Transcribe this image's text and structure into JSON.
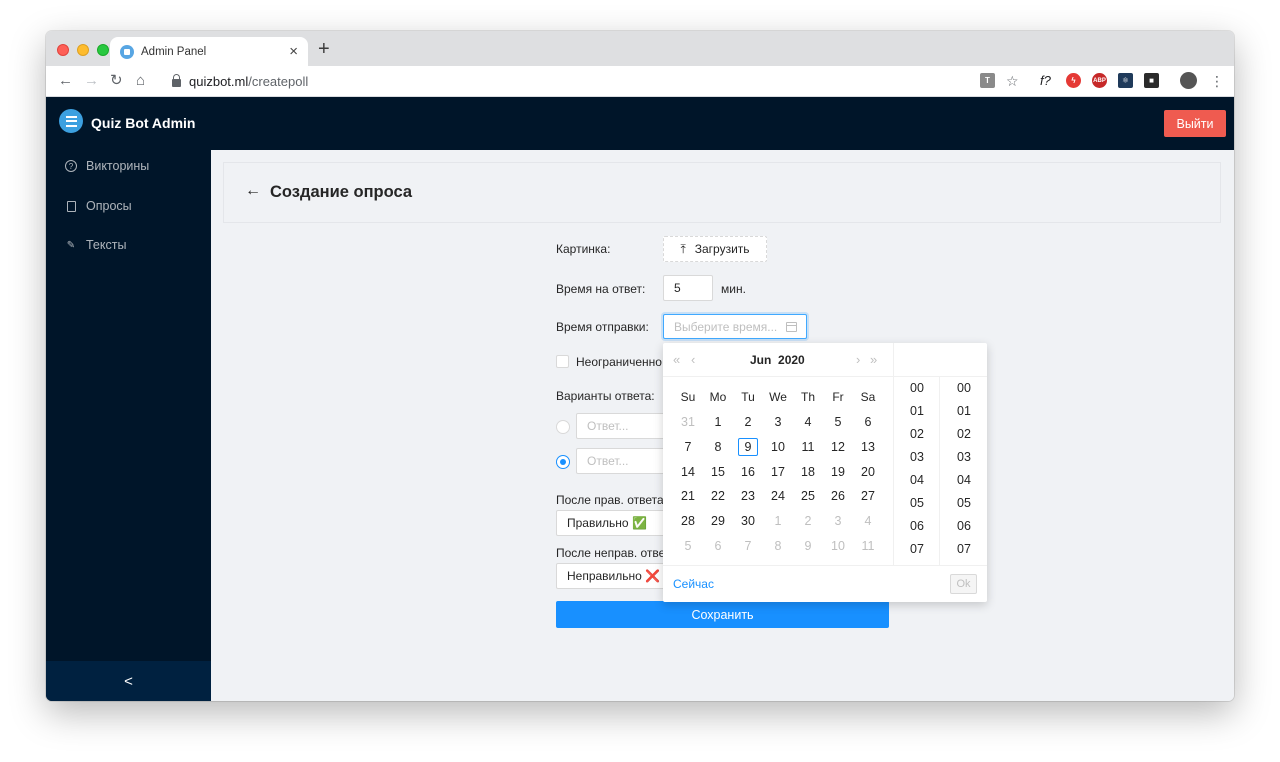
{
  "browser": {
    "tab_title": "Admin Panel",
    "tab_close": "×",
    "new_tab": "+",
    "url_host": "quizbot.ml",
    "url_path": "/createpoll",
    "ext_f": "f?"
  },
  "header": {
    "app_title": "Quiz Bot Admin",
    "logout_label": "Выйти"
  },
  "sidebar": {
    "items": [
      {
        "label": "Викторины",
        "icon": "question-circle-icon"
      },
      {
        "label": "Опросы",
        "icon": "file-icon"
      },
      {
        "label": "Тексты",
        "icon": "edit-icon"
      }
    ],
    "collapse_glyph": "<"
  },
  "page": {
    "back_glyph": "←",
    "title": "Создание опроса"
  },
  "form": {
    "image_label": "Картинка:",
    "upload_label": "Загрузить",
    "answer_time_label": "Время на ответ:",
    "answer_time_value": "5",
    "answer_time_unit": "мин.",
    "send_time_label": "Время отправки:",
    "send_time_placeholder": "Выберите время...",
    "unlimited_label": "Неограниченно",
    "options_label": "Варианты ответа:",
    "option_placeholder": "Ответ...",
    "after_correct_label": "После прав. ответа",
    "after_correct_value": "Правильно ✅",
    "after_wrong_label": "После неправ. отве",
    "after_wrong_value": "Неправильно ❌",
    "save_label": "Сохранить"
  },
  "datepicker": {
    "month": "Jun",
    "year": "2020",
    "prev_year": "«",
    "prev_month": "‹",
    "next_month": "›",
    "next_year": "»",
    "weekdays": [
      "Su",
      "Mo",
      "Tu",
      "We",
      "Th",
      "Fr",
      "Sa"
    ],
    "weeks": [
      [
        "31",
        "1",
        "2",
        "3",
        "4",
        "5",
        "6"
      ],
      [
        "7",
        "8",
        "9",
        "10",
        "11",
        "12",
        "13"
      ],
      [
        "14",
        "15",
        "16",
        "17",
        "18",
        "19",
        "20"
      ],
      [
        "21",
        "22",
        "23",
        "24",
        "25",
        "26",
        "27"
      ],
      [
        "28",
        "29",
        "30",
        "1",
        "2",
        "3",
        "4"
      ],
      [
        "5",
        "6",
        "7",
        "8",
        "9",
        "10",
        "11"
      ]
    ],
    "today": "9",
    "hours": [
      "00",
      "01",
      "02",
      "03",
      "04",
      "05",
      "06",
      "07"
    ],
    "minutes": [
      "00",
      "01",
      "02",
      "03",
      "04",
      "05",
      "06",
      "07"
    ],
    "now_label": "Сейчас",
    "ok_label": "Ok"
  },
  "colors": {
    "header_bg": "#001529",
    "accent": "#1890ff",
    "danger": "#ef5b50"
  }
}
